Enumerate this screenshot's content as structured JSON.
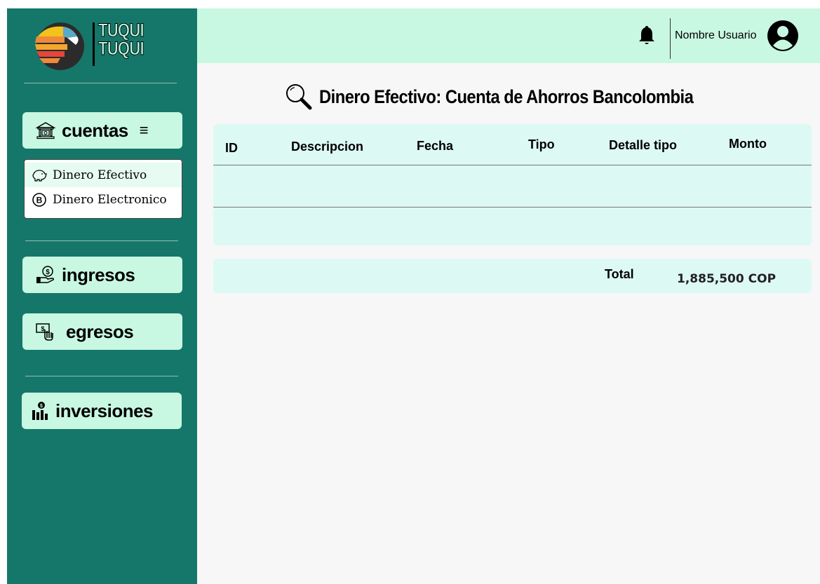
{
  "brand": {
    "line1": "TUQUI",
    "line2": "TUQUI"
  },
  "sidebar": {
    "cuentas": {
      "label": "cuentas",
      "menu_glyph": "≡",
      "icon": "bank-icon"
    },
    "submenu": [
      {
        "label": "Dinero Efectivo",
        "icon": "piggy-bank-icon",
        "active": true
      },
      {
        "label": "Dinero Electronico",
        "icon": "bitcoin-icon",
        "active": false
      }
    ],
    "ingresos": {
      "label": "ingresos",
      "icon": "hand-coin-icon"
    },
    "egresos": {
      "label": "egresos",
      "icon": "cash-hand-icon"
    },
    "inversiones": {
      "label": "inversiones",
      "icon": "investment-chart-icon"
    }
  },
  "header": {
    "user_name": "Nombre Usuario",
    "bell_icon": "bell-icon",
    "avatar_icon": "user-avatar-icon"
  },
  "main": {
    "title": "Dinero Efectivo: Cuenta de Ahorros Bancolombia",
    "table": {
      "columns": [
        "ID",
        "Descripcion",
        "Fecha",
        "Tipo",
        "Detalle tipo",
        "Monto"
      ],
      "rows": []
    },
    "total": {
      "label": "Total",
      "value": "1,885,500 COP"
    }
  },
  "colors": {
    "sidebar": "#157769",
    "accent_light": "#c8f8e2",
    "table_bg": "#ddf9f3",
    "page_bg": "#f7f7f7"
  }
}
